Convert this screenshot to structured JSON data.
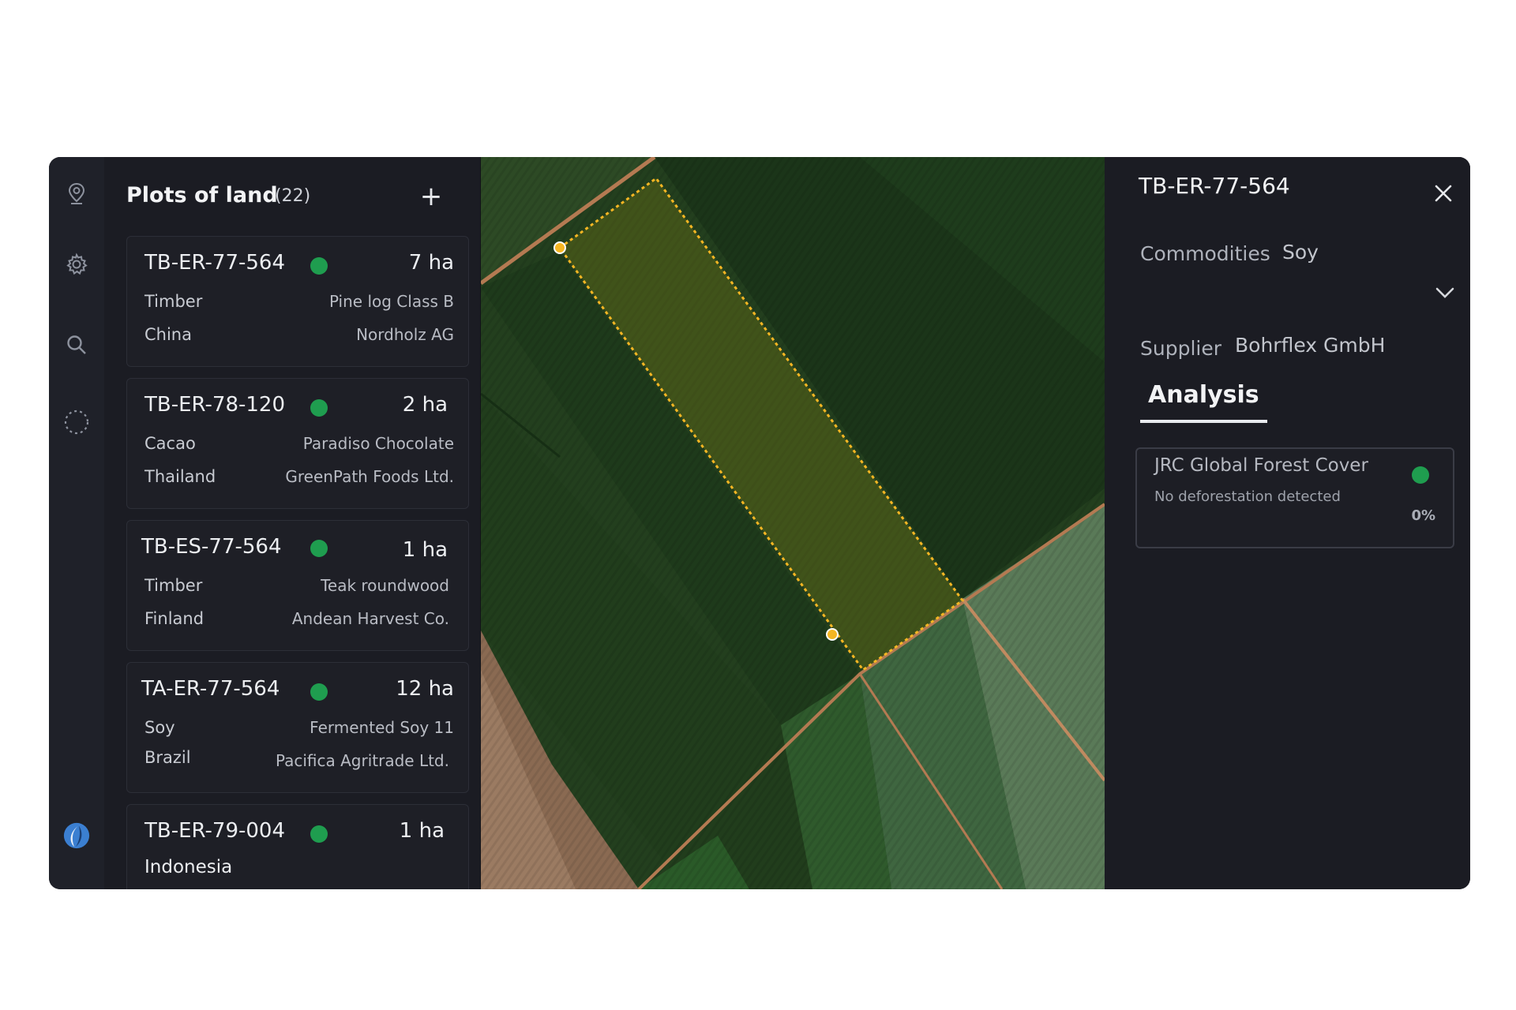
{
  "plots_panel": {
    "title": "Plots of land",
    "count": "(22)",
    "add_label": "+"
  },
  "plots": [
    {
      "id": "TB-ER-77-564",
      "area": "7 ha",
      "commodity": "Timber",
      "product": "Pine log Class B",
      "country": "China",
      "company": "Nordholz AG",
      "status_color": "#1f9d4f"
    },
    {
      "id": "TB-ER-78-120",
      "area": "2 ha",
      "commodity": "Cacao",
      "product": "Paradiso Chocolate",
      "country": "Thailand",
      "company": "GreenPath Foods Ltd.",
      "status_color": "#1f9d4f"
    },
    {
      "id": "TB-ES-77-564",
      "area": "1 ha",
      "commodity": "Timber",
      "product": "Teak roundwood",
      "country": "Finland",
      "company": "Andean Harvest Co.",
      "status_color": "#1f9d4f"
    },
    {
      "id": "TA-ER-77-564",
      "area": "12 ha",
      "commodity": "Soy",
      "product": "Fermented Soy 11",
      "country": "Brazil",
      "company": "Pacifica Agritrade Ltd.",
      "status_color": "#1f9d4f"
    },
    {
      "id": "TB-ER-79-004",
      "area": "1 ha",
      "commodity": "",
      "product": "",
      "country": "Indonesia",
      "company": "",
      "status_color": "#1f9d4f"
    }
  ],
  "detail": {
    "id": "TB-ER-77-564",
    "commodities_label": "Commodities",
    "commodities_value": "Soy",
    "supplier_label": "Supplier",
    "supplier_value": "Bohrflex GmbH",
    "tab_label": "Analysis",
    "analysis": {
      "name": "JRC Global Forest Cover",
      "status": "No deforestation detected",
      "percent": "0%",
      "status_color": "#1f9d4f"
    }
  },
  "icons": {
    "rail": [
      "map-pin-icon",
      "gear-icon",
      "search-icon",
      "loading-circle-icon",
      "brand-logo-icon"
    ],
    "close": "close-icon",
    "expand": "chevron-down-icon"
  },
  "colors": {
    "panel_bg": "#1b1c23",
    "status_green": "#1f9d4f",
    "selection_outline": "#f5b623"
  }
}
